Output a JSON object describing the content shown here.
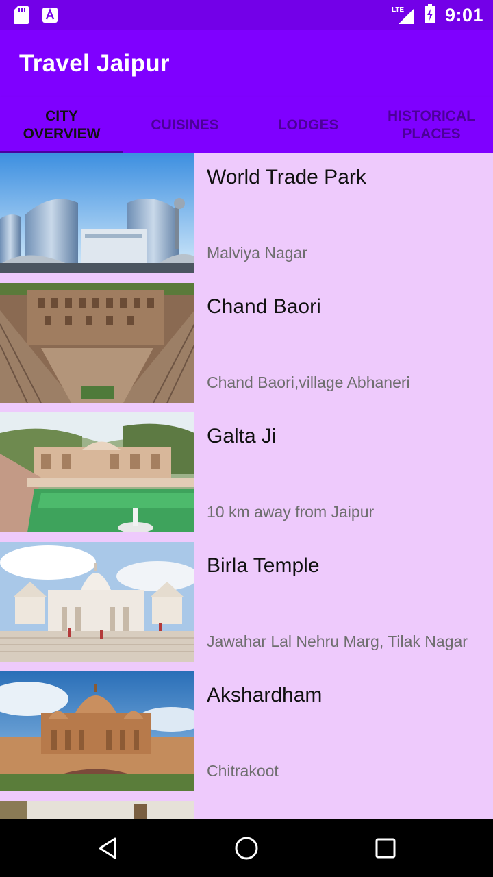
{
  "status_bar": {
    "time": "9:01",
    "network_label": "LTE",
    "icons": [
      "sd-card-icon",
      "app-notification-icon",
      "lte-signal-icon",
      "battery-charging-icon"
    ]
  },
  "app_bar": {
    "title": "Travel Jaipur"
  },
  "tabs": [
    {
      "label": "City Overview",
      "active": true
    },
    {
      "label": "Cuisines",
      "active": false
    },
    {
      "label": "Lodges",
      "active": false
    },
    {
      "label": "Historical Places",
      "active": false
    }
  ],
  "places": [
    {
      "title": "World Trade Park",
      "subtitle": "Malviya Nagar",
      "image": "world-trade-park-image"
    },
    {
      "title": "Chand Baori",
      "subtitle": "Chand Baori,village Abhaneri",
      "image": "chand-baori-image"
    },
    {
      "title": "Galta Ji",
      "subtitle": "10 km away from Jaipur",
      "image": "galta-ji-image"
    },
    {
      "title": "Birla Temple",
      "subtitle": "Jawahar Lal Nehru Marg, Tilak Nagar",
      "image": "birla-temple-image"
    },
    {
      "title": "Akshardham",
      "subtitle": "Chitrakoot",
      "image": "akshardham-image"
    },
    {
      "title": "",
      "subtitle": "",
      "image": "partial-item-image"
    }
  ],
  "nav_bar": {
    "icons": [
      "back-icon",
      "home-icon",
      "recents-icon"
    ]
  },
  "colors": {
    "primary": "#7f00ff",
    "status_bar": "#7300e8",
    "list_background": "#eecafc",
    "tab_indicator": "#4a00a0"
  }
}
